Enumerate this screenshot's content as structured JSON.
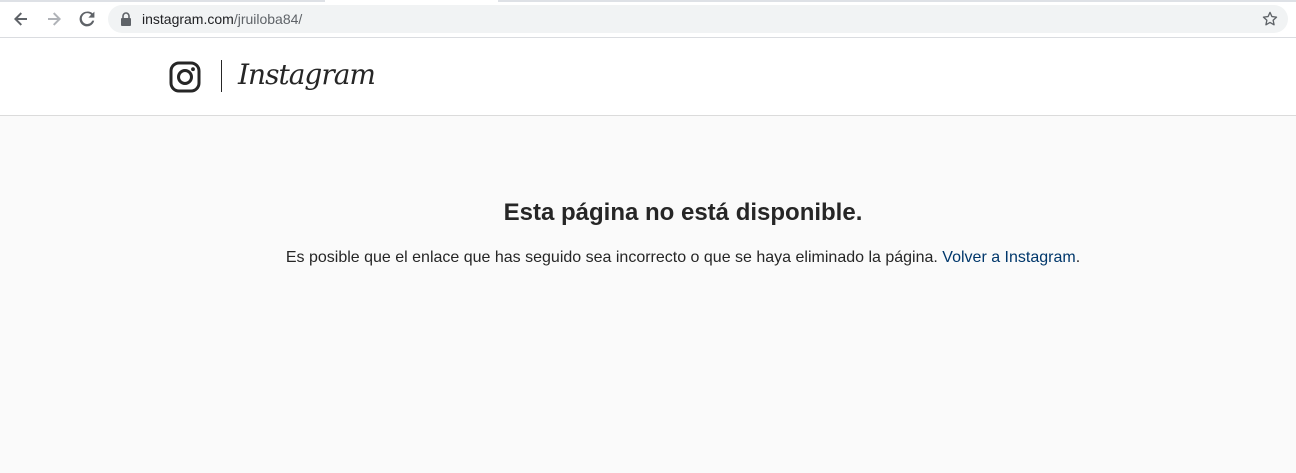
{
  "browser": {
    "url_host": "instagram.com",
    "url_path": "/jruiloba84/"
  },
  "header": {
    "wordmark": "Instagram"
  },
  "error": {
    "title": "Esta página no está disponible.",
    "message": "Es posible que el enlace que has seguido sea incorrecto o que se haya eliminado la página.",
    "link_text": "Volver a Instagram",
    "trailing": "."
  },
  "colors": {
    "text": "#262626",
    "link": "#00376b",
    "page_bg": "#fafafa",
    "header_bg": "#ffffff",
    "omnibox_bg": "#f1f3f4"
  },
  "icons": [
    "back-arrow-icon",
    "forward-arrow-icon",
    "reload-icon",
    "lock-icon",
    "bookmark-star-icon",
    "instagram-glyph-icon"
  ]
}
